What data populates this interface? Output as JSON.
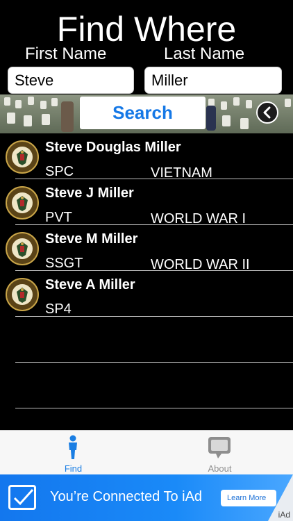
{
  "header": {
    "title": "Find Where",
    "first_name_label": "First Name",
    "last_name_label": "Last Name",
    "first_name_value": "Steve",
    "last_name_value": "Miller"
  },
  "search": {
    "button_label": "Search"
  },
  "results": [
    {
      "name": "Steve Douglas Miller",
      "rank": "SPC",
      "war": "VIETNAM"
    },
    {
      "name": "Steve J Miller",
      "rank": "PVT",
      "war": "WORLD WAR I"
    },
    {
      "name": "Steve M Miller",
      "rank": "SSGT",
      "war": "WORLD WAR II"
    },
    {
      "name": "Steve A Miller",
      "rank": "SP4",
      "war": ""
    }
  ],
  "seal": {
    "icon": "us-army-seal-icon",
    "text_top": "UNITED STATES",
    "text_bottom": "ARMY"
  },
  "tabbar": {
    "tabs": [
      {
        "label": "Find",
        "icon": "person-icon",
        "selected": true
      },
      {
        "label": "About",
        "icon": "speech-bubble-icon",
        "selected": false
      }
    ]
  },
  "ad": {
    "text": "You’re Connected To iAd",
    "button_label": "Learn More",
    "tag": "iAd"
  },
  "colors": {
    "background": "#000000",
    "accent": "#1578e6",
    "ad_banner": "#1a8af8",
    "tab_inactive": "#8e8e8e"
  }
}
